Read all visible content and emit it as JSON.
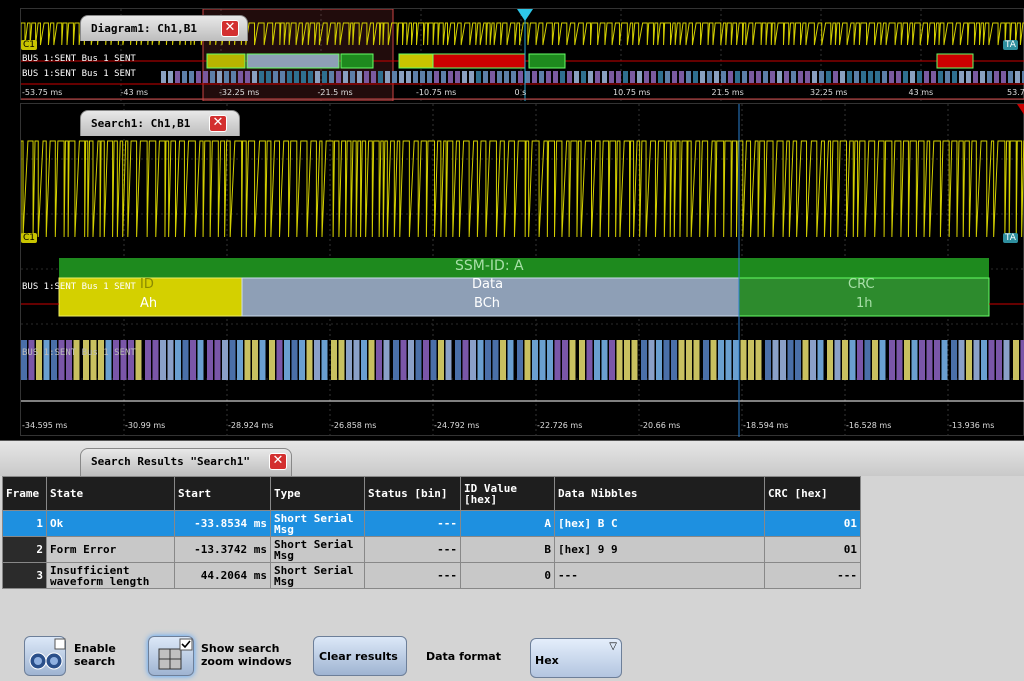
{
  "diagram": {
    "tab_title": "Diagram1: Ch1,B1",
    "channel_tag": "C1",
    "trigger_tag": "TA",
    "bus_decode_label": "BUS 1:SENT Bus 1 SENT",
    "bus_bits_label": "BUS 1:SENT Bus 1 SENT",
    "time_ticks": [
      "-53.75 ms",
      "-43 ms",
      "-32.25 ms",
      "-21.5 ms",
      "-10.75 ms",
      "0 s",
      "10.75 ms",
      "21.5 ms",
      "32.25 ms",
      "43 ms",
      "53.75 ms"
    ]
  },
  "search": {
    "tab_title": "Search1: Ch1,B1",
    "channel_tag": "C1",
    "trigger_tag": "TA",
    "bus_label": "BUS 1:SENT Bus 1 SENT",
    "frame_label": "SSM-ID: A",
    "field_id_name": "ID",
    "field_id_value": "Ah",
    "field_data_name": "Data",
    "field_data_value": "BCh",
    "field_crc_name": "CRC",
    "field_crc_value": "1h",
    "bits_label": "BUS 1:SENT Bus 1 SENT",
    "time_ticks": [
      "-34.595 ms",
      "-30.99 ms",
      "-28.924 ms",
      "-26.858 ms",
      "-24.792 ms",
      "-22.726 ms",
      "-20.66 ms",
      "-18.594 ms",
      "-16.528 ms",
      "-13.936 ms"
    ]
  },
  "results": {
    "tab_title": "Search Results \"Search1\"",
    "columns": [
      "Frame",
      "State",
      "Start",
      "Type",
      "Status [bin]",
      "ID Value [hex]",
      "Data Nibbles",
      "CRC [hex]"
    ],
    "rows": [
      {
        "frame": "1",
        "state": "Ok",
        "start": "-33.8534 ms",
        "type": "Short Serial Msg",
        "status": "---",
        "id": "A",
        "data": "[hex] B C",
        "crc": "01"
      },
      {
        "frame": "2",
        "state": "Form Error",
        "start": "-13.3742 ms",
        "type": "Short Serial Msg",
        "status": "---",
        "id": "B",
        "data": "[hex] 9 9",
        "crc": "01"
      },
      {
        "frame": "3",
        "state": "Insufficient waveform length",
        "start": "44.2064 ms",
        "type": "Short Serial Msg",
        "status": "---",
        "id": "0",
        "data": "---",
        "crc": "---"
      }
    ]
  },
  "toolbar": {
    "enable_search_label": "Enable search",
    "show_zoom_label": "Show search zoom windows",
    "clear_results_label": "Clear results",
    "data_format_label": "Data format",
    "data_format_value": "Hex"
  },
  "colors": {
    "signal_yellow": "#d4d000",
    "frame_green": "#1e8a1e",
    "data_gray": "#8e9fb6",
    "crc_green": "#2d8b2d",
    "error_red": "#cc0000",
    "selected_blue": "#1e90e0"
  }
}
